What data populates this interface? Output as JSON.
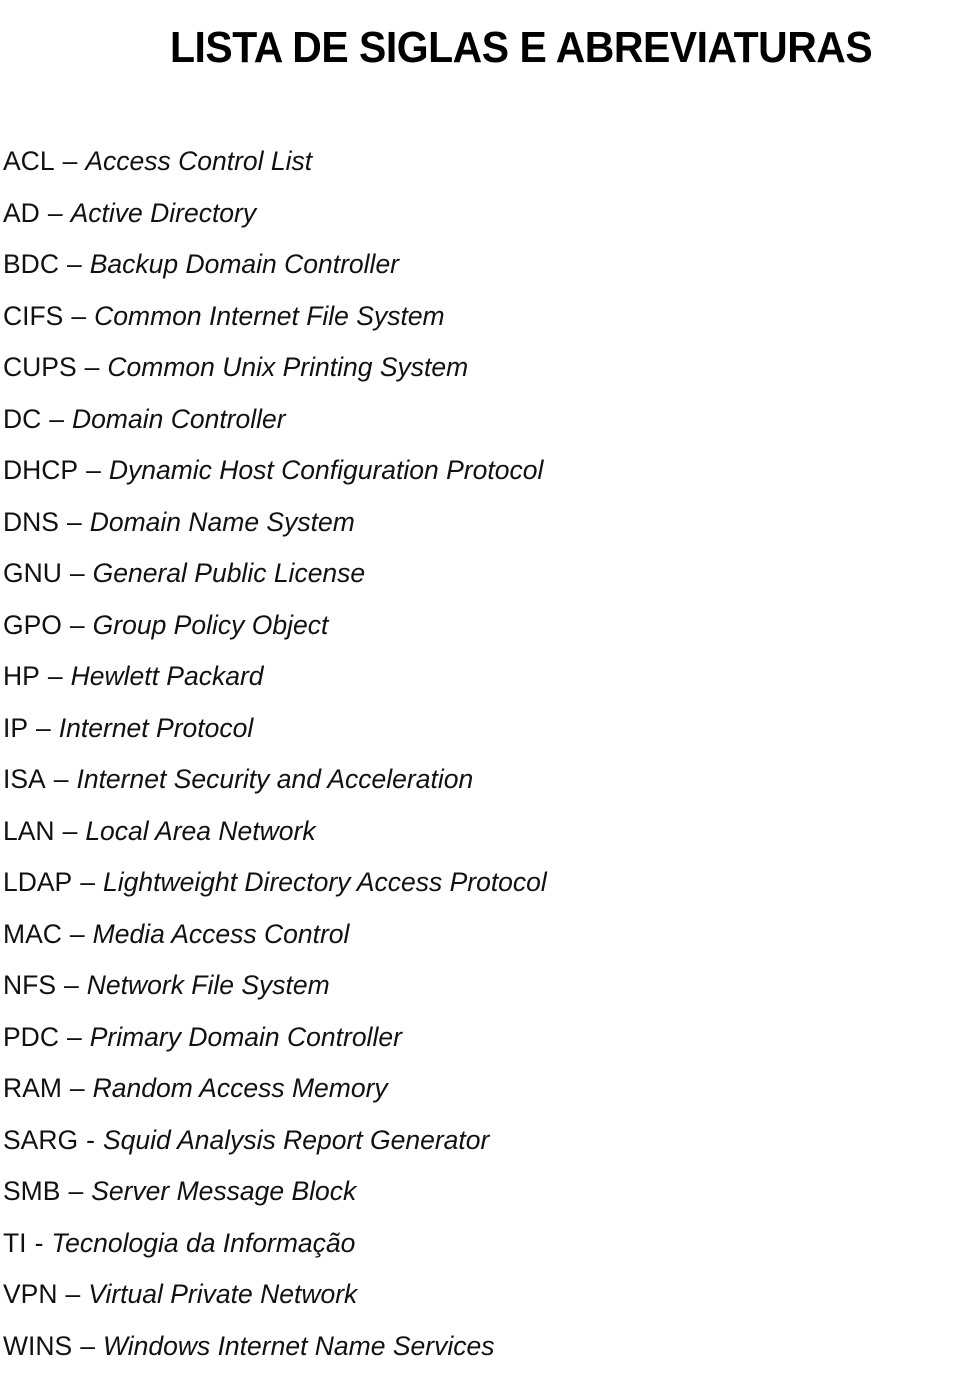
{
  "title": "LISTA DE SIGLAS E ABREVIATURAS",
  "items": [
    {
      "abbr": "ACL",
      "sep": "–",
      "meaning": "Access Control List"
    },
    {
      "abbr": "AD",
      "sep": "–",
      "meaning": "Active Directory"
    },
    {
      "abbr": "BDC",
      "sep": "–",
      "meaning": "Backup Domain Controller"
    },
    {
      "abbr": "CIFS",
      "sep": "–",
      "meaning": "Common Internet File System"
    },
    {
      "abbr": "CUPS",
      "sep": "–",
      "meaning": "Common Unix Printing System"
    },
    {
      "abbr": "DC",
      "sep": "–",
      "meaning": "Domain Controller"
    },
    {
      "abbr": "DHCP",
      "sep": "–",
      "meaning": "Dynamic Host Configuration Protocol"
    },
    {
      "abbr": "DNS",
      "sep": "–",
      "meaning": "Domain Name System"
    },
    {
      "abbr": "GNU",
      "sep": "–",
      "meaning": "General Public License"
    },
    {
      "abbr": "GPO",
      "sep": "–",
      "meaning": "Group Policy Object"
    },
    {
      "abbr": "HP",
      "sep": "–",
      "meaning": "Hewlett Packard"
    },
    {
      "abbr": "IP",
      "sep": "–",
      "meaning": "Internet Protocol"
    },
    {
      "abbr": "ISA",
      "sep": "–",
      "meaning": "Internet Security and Acceleration"
    },
    {
      "abbr": "LAN",
      "sep": "–",
      "meaning": "Local Area Network"
    },
    {
      "abbr": "LDAP",
      "sep": "–",
      "meaning": "Lightweight Directory Access Protocol"
    },
    {
      "abbr": "MAC",
      "sep": "–",
      "meaning": "Media Access Control"
    },
    {
      "abbr": "NFS",
      "sep": "–",
      "meaning": "Network File System"
    },
    {
      "abbr": "PDC",
      "sep": "–",
      "meaning": "Primary Domain Controller"
    },
    {
      "abbr": "RAM",
      "sep": "–",
      "meaning": "Random Access Memory"
    },
    {
      "abbr": "SARG",
      "sep": "-",
      "meaning": "Squid Analysis Report Generator"
    },
    {
      "abbr": "SMB",
      "sep": "–",
      "meaning": "Server Message Block"
    },
    {
      "abbr": "TI",
      "sep": "-",
      "meaning": "Tecnologia da Informação"
    },
    {
      "abbr": "VPN",
      "sep": "–",
      "meaning": "Virtual Private Network"
    },
    {
      "abbr": "WINS",
      "sep": "–",
      "meaning": "Windows Internet Name Services"
    }
  ]
}
